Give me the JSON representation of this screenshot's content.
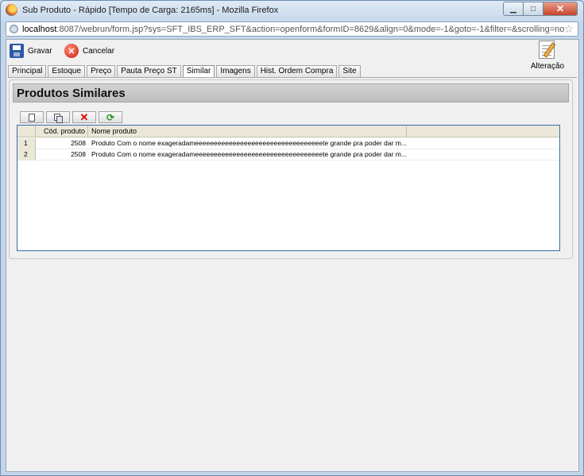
{
  "window": {
    "title": "Sub Produto - Rápido [Tempo de Carga: 2165ms] - Mozilla Firefox",
    "url_host": "localhost",
    "url_rest": ":8087/webrun/form.jsp?sys=SFT_IBS_ERP_SFT&action=openform&formID=8629&align=0&mode=-1&goto=-1&filter=&scrolling=no",
    "minimize": "▁",
    "maximize": "□",
    "close": "✕"
  },
  "toolbar": {
    "save_label": "Gravar",
    "cancel_label": "Cancelar",
    "cancel_glyph": "✕",
    "mode_label": "Alteração"
  },
  "tabs": [
    {
      "label": "Principal"
    },
    {
      "label": "Estoque"
    },
    {
      "label": "Preço"
    },
    {
      "label": "Pauta Preço ST"
    },
    {
      "label": "Similar",
      "active": true
    },
    {
      "label": "Imagens"
    },
    {
      "label": "Hist. Ordem Compra"
    },
    {
      "label": "Site"
    }
  ],
  "section": {
    "title": "Produtos Similares"
  },
  "grid_toolbar": {
    "delete_glyph": "✕",
    "refresh_glyph": "⟳"
  },
  "grid": {
    "columns": [
      "Cód. produto",
      "Nome produto"
    ],
    "rows": [
      {
        "num": "1",
        "cod": "2508",
        "nome": "Produto Com o nome exageradameeeeeeeeeeeeeeeeeeeeeeeeeeeeeeeeeete grande pra poder dar m..."
      },
      {
        "num": "2",
        "cod": "2508",
        "nome": "Produto Com o nome exageradameeeeeeeeeeeeeeeeeeeeeeeeeeeeeeeeeete grande pra poder dar m..."
      }
    ]
  },
  "colors": {
    "accent": "#3a6ea5",
    "header_bg": "#ebe8d9"
  }
}
